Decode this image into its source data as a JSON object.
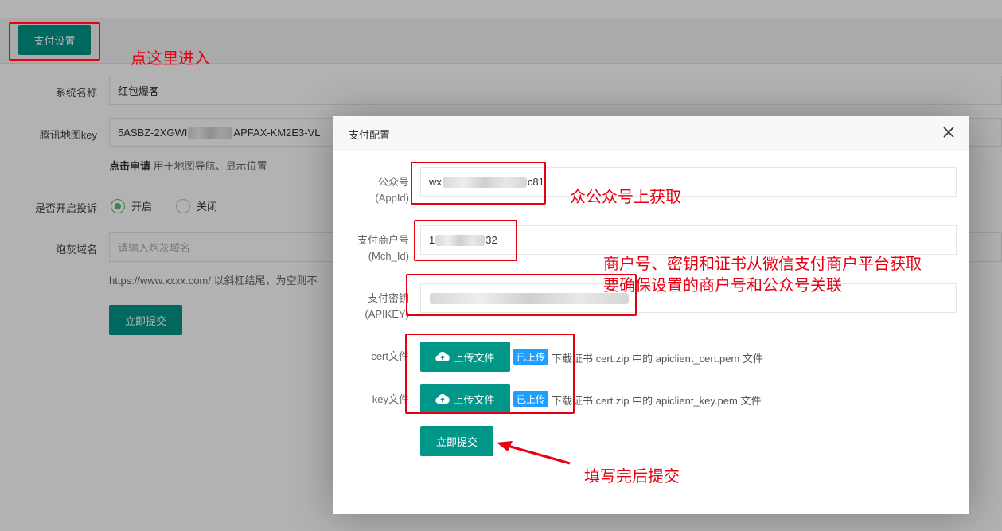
{
  "background_page": {
    "pay_settings_button": "支付设置",
    "fields": {
      "system_name": {
        "label": "系统名称",
        "value": "红包爆客"
      },
      "map_key": {
        "label": "腾讯地图key",
        "value_start": "5ASBZ-2XGWI",
        "value_end": "APFAX-KM2E3-VL"
      },
      "map_hint_link": "点击申请",
      "map_hint_text": "用于地图导航、显示位置",
      "complaint": {
        "label": "是否开启投诉",
        "option_on": "开启",
        "option_off": "关闭",
        "selected": "开启"
      },
      "cannon_domain": {
        "label": "炮灰域名",
        "placeholder": "请输入炮灰域名"
      },
      "domain_hint": "https://www.xxxx.com/ 以斜杠结尾，为空则不"
    },
    "submit_label": "立即提交"
  },
  "modal": {
    "title": "支付配置",
    "fields": {
      "appid": {
        "label_line1": "公众号",
        "label_line2": "(AppId)",
        "value_start": "wx",
        "value_end": "c81"
      },
      "mch_id": {
        "label_line1": "支付商户号",
        "label_line2": "(Mch_Id)",
        "value_start": "1",
        "value_end": "32"
      },
      "apikey": {
        "label_line1": "支付密钥",
        "label_line2": "(APIKEY)"
      }
    },
    "cert": {
      "label": "cert文件",
      "upload_label": "上传文件",
      "status": "已上传",
      "hint": "下载证书 cert.zip 中的 apiclient_cert.pem 文件"
    },
    "key": {
      "label": "key文件",
      "upload_label": "上传文件",
      "status": "已上传",
      "hint": "下载证书 cert.zip 中的 apiclient_key.pem 文件"
    },
    "submit_label": "立即提交"
  },
  "annotations": {
    "click_here": "点这里进入",
    "get_from_official": "众公众号上获取",
    "merchant_line1": "商户号、密钥和证书从微信支付商户平台获取",
    "merchant_line2": "要确保设置的商户号和公众号关联",
    "submit_after": "填写完后提交"
  },
  "colors": {
    "primary": "#009688",
    "annotation": "#e60012",
    "badge": "#1e9fff",
    "radio_checked": "#5fb878"
  },
  "icons": {
    "close": "close-icon",
    "upload": "cloud-upload-icon"
  }
}
